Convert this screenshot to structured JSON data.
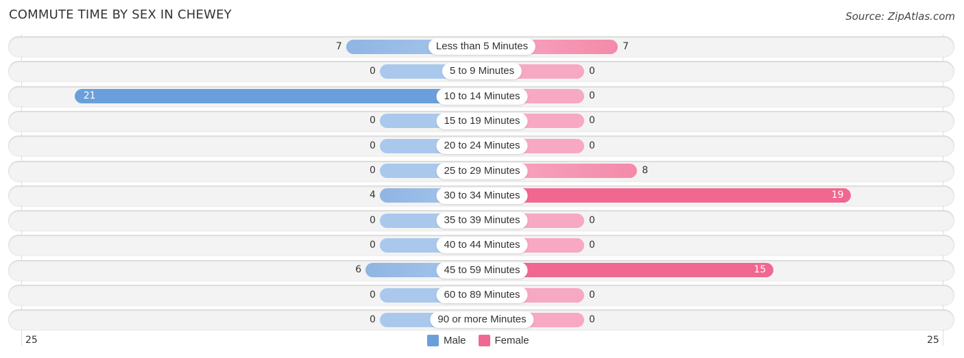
{
  "chart_data": {
    "type": "bar",
    "orientation": "horizontal-diverging",
    "title": "COMMUTE TIME BY SEX IN CHEWEY",
    "source": "Source: ZipAtlas.com",
    "categories": [
      "Less than 5 Minutes",
      "5 to 9 Minutes",
      "10 to 14 Minutes",
      "15 to 19 Minutes",
      "20 to 24 Minutes",
      "25 to 29 Minutes",
      "30 to 34 Minutes",
      "35 to 39 Minutes",
      "40 to 44 Minutes",
      "45 to 59 Minutes",
      "60 to 89 Minutes",
      "90 or more Minutes"
    ],
    "series": [
      {
        "name": "Male",
        "color": "#6a9fdb",
        "light_color": "#a9c8ec",
        "values": [
          7,
          0,
          21,
          0,
          0,
          0,
          4,
          0,
          0,
          6,
          0,
          0
        ]
      },
      {
        "name": "Female",
        "color": "#f06891",
        "light_color": "#f7a8c2",
        "values": [
          7,
          0,
          0,
          0,
          0,
          8,
          19,
          0,
          0,
          15,
          0,
          0
        ]
      }
    ],
    "xlim": [
      -25,
      25
    ],
    "axis_tick_labels": {
      "left": "25",
      "right": "25"
    },
    "legend": {
      "position": "bottom-center",
      "items": [
        "Male",
        "Female"
      ]
    },
    "grid": false
  }
}
